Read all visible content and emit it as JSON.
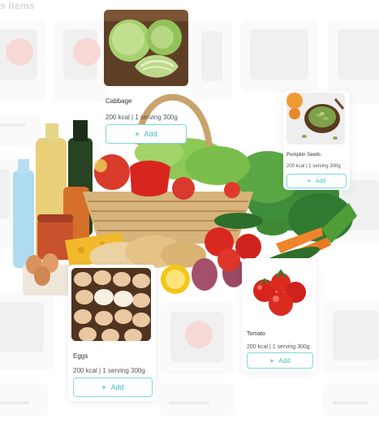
{
  "background": {
    "heading": "s Items"
  },
  "cards": {
    "cabbage": {
      "name": "Cabbage",
      "meta": "200 kcal | 1 serving 300g",
      "add_label": "Add",
      "icon": "plus-icon"
    },
    "pumpkin": {
      "name": "Pumpkin Seeds",
      "meta": "200 kcal | 1 serving 300g",
      "add_label": "Add",
      "icon": "plus-icon"
    },
    "eggs": {
      "name": "Eggs",
      "meta": "200 kcal | 1 serving 300g",
      "add_label": "Add",
      "icon": "plus-icon"
    },
    "tomato": {
      "name": "Tomato",
      "meta": "200 kcal | 1 serving 300g",
      "add_label": "Add",
      "icon": "plus-icon"
    }
  },
  "colors": {
    "accent": "#3fbfc0",
    "accent_border": "#7fd7d7"
  }
}
